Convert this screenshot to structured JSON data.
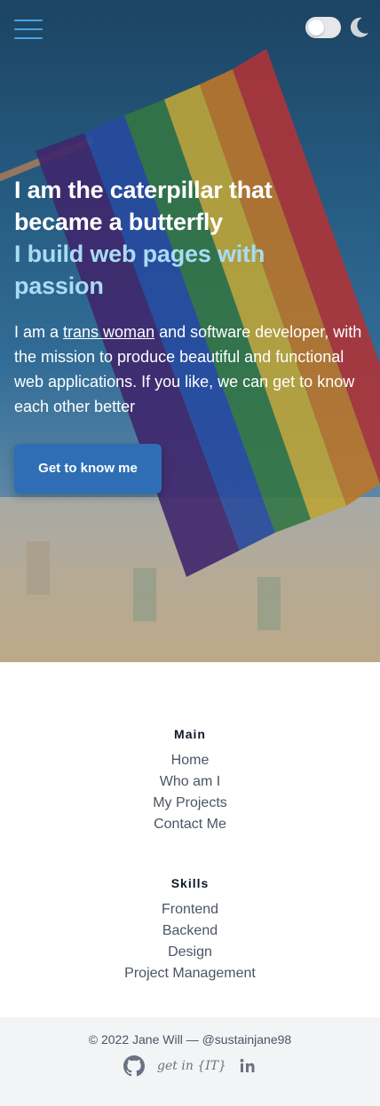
{
  "colors": {
    "accent": "#2f6eb5",
    "headline_secondary": "#a9dbf4",
    "menu_icon": "#4aa3df"
  },
  "header": {
    "menu_icon": "hamburger-menu-icon",
    "theme_toggle_icon": "moon-icon"
  },
  "hero": {
    "headline_line1": "I am the caterpillar that",
    "headline_line2": "became a butterfly",
    "subheadline_line1": "I build web pages with",
    "subheadline_line2": "passion",
    "intro_prefix": "I am a ",
    "intro_link": "trans woman",
    "intro_suffix": " and software developer, with the mission to produce beautiful and functional web applications. If you like, we can get to know each other better",
    "cta_label": "Get to know me"
  },
  "footer": {
    "groups": [
      {
        "title": "Main",
        "items": [
          "Home",
          "Who am I",
          "My Projects",
          "Contact Me"
        ]
      },
      {
        "title": "Skills",
        "items": [
          "Frontend",
          "Backend",
          "Design",
          "Project Management"
        ]
      }
    ],
    "copyright": "© 2022 Jane Will — @sustainjane98",
    "getin_label": "get in {IT}",
    "social_icons": [
      "github-icon",
      "getinit-icon",
      "linkedin-icon"
    ]
  }
}
